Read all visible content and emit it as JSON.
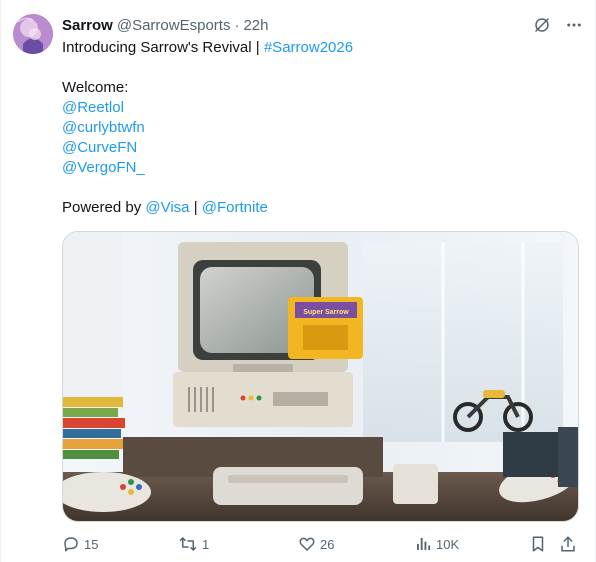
{
  "author": {
    "name": "Sarrow",
    "handle": "@SarrowEsports",
    "separator": "·",
    "time": "22h"
  },
  "tweet": {
    "intro_text": "Introducing Sarrow's Revival | ",
    "hashtag": "#Sarrow2026",
    "welcome_label": "Welcome:",
    "mentions": [
      "@Reetlol",
      "@curlybtwfn",
      "@CurveFN",
      "@VergoFN_"
    ],
    "powered_by_label": "Powered by ",
    "sponsor_1": "@Visa",
    "sponsor_separator": " | ",
    "sponsor_2": "@Fortnite",
    "image_cartridge_label": "Super Sarrow"
  },
  "header_icons": [
    "grok-icon",
    "more-icon"
  ],
  "actions": {
    "replies": "15",
    "reposts": "1",
    "likes": "26",
    "views": "10K"
  },
  "colors": {
    "link": "#1d9bf0",
    "secondary_text": "#536471",
    "border": "#cfd9de"
  }
}
